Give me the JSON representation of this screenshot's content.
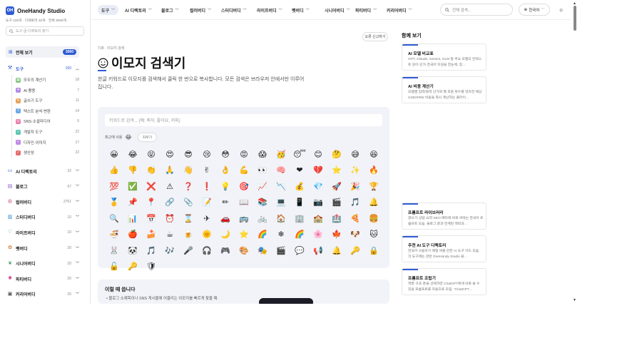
{
  "brand": {
    "logo_letters": "OH",
    "name": "OneHandy Studio",
    "stats": "도구 100개 · 디렉토리 32개 · 전체 3060개"
  },
  "sidebar": {
    "search_placeholder": "도구·글·디렉토리 찾기",
    "all": {
      "label": "전체 보기",
      "count": "3060"
    },
    "tool": {
      "label": "도구",
      "count": "100"
    },
    "subitems": [
      {
        "label": "모두의 계산기",
        "count": "18",
        "color": "#7fc47a",
        "icon": "calculator-icon",
        "glyph": "▦"
      },
      {
        "label": "AI 활용",
        "count": "7",
        "color": "#b48ae8",
        "icon": "ai-icon",
        "glyph": "✦"
      },
      {
        "label": "글쓰기 도구",
        "count": "11",
        "color": "#e8a25a",
        "icon": "pen-icon",
        "glyph": "✎"
      },
      {
        "label": "텍스트 분석·변환",
        "count": "14",
        "color": "#6ca9e8",
        "icon": "text-icon",
        "glyph": "T"
      },
      {
        "label": "SNS·소셜미디어",
        "count": "6",
        "color": "#e87aa8",
        "icon": "share-icon",
        "glyph": "◎"
      },
      {
        "label": "개발자 도구",
        "count": "22",
        "color": "#5ac4b0",
        "icon": "code-icon",
        "glyph": "‹›"
      },
      {
        "label": "디자인·이미지",
        "count": "17",
        "color": "#c08ae8",
        "icon": "palette-icon",
        "glyph": "◐"
      },
      {
        "label": "생산성",
        "count": "22",
        "color": "#e86a6a",
        "icon": "check-icon",
        "glyph": "✓"
      }
    ],
    "categories": [
      {
        "label": "AI 디렉토리",
        "count": "32",
        "icon": "ai-directory-icon",
        "glyph": "▭",
        "color": "#2f5bd3"
      },
      {
        "label": "블로그",
        "count": "67",
        "icon": "blog-icon",
        "glyph": "▤",
        "color": "#8a5ad3"
      },
      {
        "label": "컬러버디",
        "count": "2761",
        "icon": "color-icon",
        "glyph": "◍",
        "color": "#d35a8a"
      },
      {
        "label": "스터디버디",
        "count": "10",
        "icon": "study-icon",
        "glyph": "▥",
        "color": "#2f8ad3"
      },
      {
        "label": "라이프버디",
        "count": "10",
        "icon": "life-icon",
        "glyph": "♡",
        "color": "#2fa3a3"
      },
      {
        "label": "펫버디",
        "count": "20",
        "icon": "pet-icon",
        "glyph": "✿",
        "color": "#d37a2f"
      },
      {
        "label": "시니어버디",
        "count": "20",
        "icon": "senior-icon",
        "glyph": "❦",
        "color": "#3a9a5a"
      },
      {
        "label": "파티버디",
        "count": "20",
        "icon": "party-icon",
        "glyph": "✺",
        "color": "#d33a8a"
      },
      {
        "label": "커리어버디",
        "count": "20",
        "icon": "career-icon",
        "glyph": "▣",
        "color": "#555"
      }
    ]
  },
  "topnav": {
    "items": [
      "도구",
      "AI 디렉토리",
      "블로그",
      "컬러버디",
      "스터디버디",
      "라이프버디",
      "펫버디",
      "시니어버디",
      "파티버디",
      "커리어버디"
    ],
    "search_placeholder": "전체 검색...",
    "language": "한국어"
  },
  "main": {
    "breadcrumb": "T38 · 이모지 검색",
    "report_label": "오류 신고하기",
    "title": "이모지 검색기",
    "description": "한글 키워드로 이모지를 검색해서 클릭 한 번으로 복사합니다. 모든 검색은 브라우저 안에서만 이루어집니다.",
    "search_placeholder": "키워드로 검색... (예: 축하, 좋아요, 커피)",
    "recent_label": "최근에 사용",
    "recent_emoji": "😂",
    "clear_label": "지우기",
    "emojis": [
      "😀",
      "😂",
      "😝",
      "😍",
      "😎",
      "😢",
      "😳",
      "😡",
      "😱",
      "🥳",
      "😴",
      "😊",
      "🤔",
      "😅",
      "😆",
      "👍",
      "👎",
      "👏",
      "🙏",
      "👋",
      "✌",
      "👌",
      "💪",
      "👀",
      "🧠",
      "❤",
      "💔",
      "⭐",
      "✨",
      "🔥",
      "💯",
      "✅",
      "❌",
      "⚠",
      "❓",
      "❗",
      "💡",
      "🎯",
      "📈",
      "📉",
      "💰",
      "💎",
      "🚀",
      "🎉",
      "🏆",
      "🥇",
      "📌",
      "📍",
      "🔗",
      "📎",
      "📝",
      "✏",
      "📖",
      "📚",
      "💻",
      "📱",
      "📷",
      "🎬",
      "🎵",
      "🔔",
      "🔍",
      "📊",
      "📅",
      "⏰",
      "⌛",
      "✈",
      "🚗",
      "🚌",
      "🚲",
      "🏠",
      "🏢",
      "🏫",
      "🏥",
      "🍕",
      "🍔",
      "🍜",
      "🍎",
      "🍰",
      "☕",
      "🍺",
      "🌞",
      "🌙",
      "⭐",
      "🌈",
      "❄",
      "🌈",
      "🌸",
      "🍁",
      "🐶",
      "🐱",
      "🐰",
      "🐼",
      "🎵",
      "🎶",
      "🎤",
      "🎧",
      "🎮",
      "🎨",
      "🎭",
      "🎬",
      "💬",
      "📢",
      "🔔",
      "🔑",
      "🔒",
      "🔓",
      "🔑",
      "🛡"
    ],
    "info_heading": "이럴 때 씁니다",
    "info_item": "블로그 소제목이나 SNS 게시물에 어울리는 이모지를 빠르게 찾을 때."
  },
  "related": {
    "heading": "함께 보기",
    "cards": [
      {
        "title": "AI 모델 비교표",
        "desc": "GPT, Claude, Gemini, GLM 등 주요 모델의 컨텍스트 길이·단가·한국어 지원을 한눈에, 정…"
      },
      {
        "title": "AI 비용 계산기",
        "desc": "모델별 입력/출력 단가와 월 호출 횟수를 넣으면 예상 USD/KRW 비용을 즉시 계산하는 클라이…"
      },
      {
        "title": "프롬프트 라이브러리",
        "desc": "글쓰기·상담·요약·SEO 메타에 바로 써먹는 한국어 프롬프트 모음. 블로그 글과 연계된 맥락과…"
      },
      {
        "title": "추천 AI 도구 디렉토리",
        "desc": "한국어 사용자가 매일 써볼 만한 AI 도구 카드 모음. 각 도구에는 관련 OneHandy Studio 블…"
      },
      {
        "title": "프롬프트 조립기",
        "desc": "역할·구조·톤을 선택하면 ChatGPT에게 바로 쓸 수 있을 프롬프트를 자동으로 조립. \"ChatGPT…"
      }
    ]
  }
}
